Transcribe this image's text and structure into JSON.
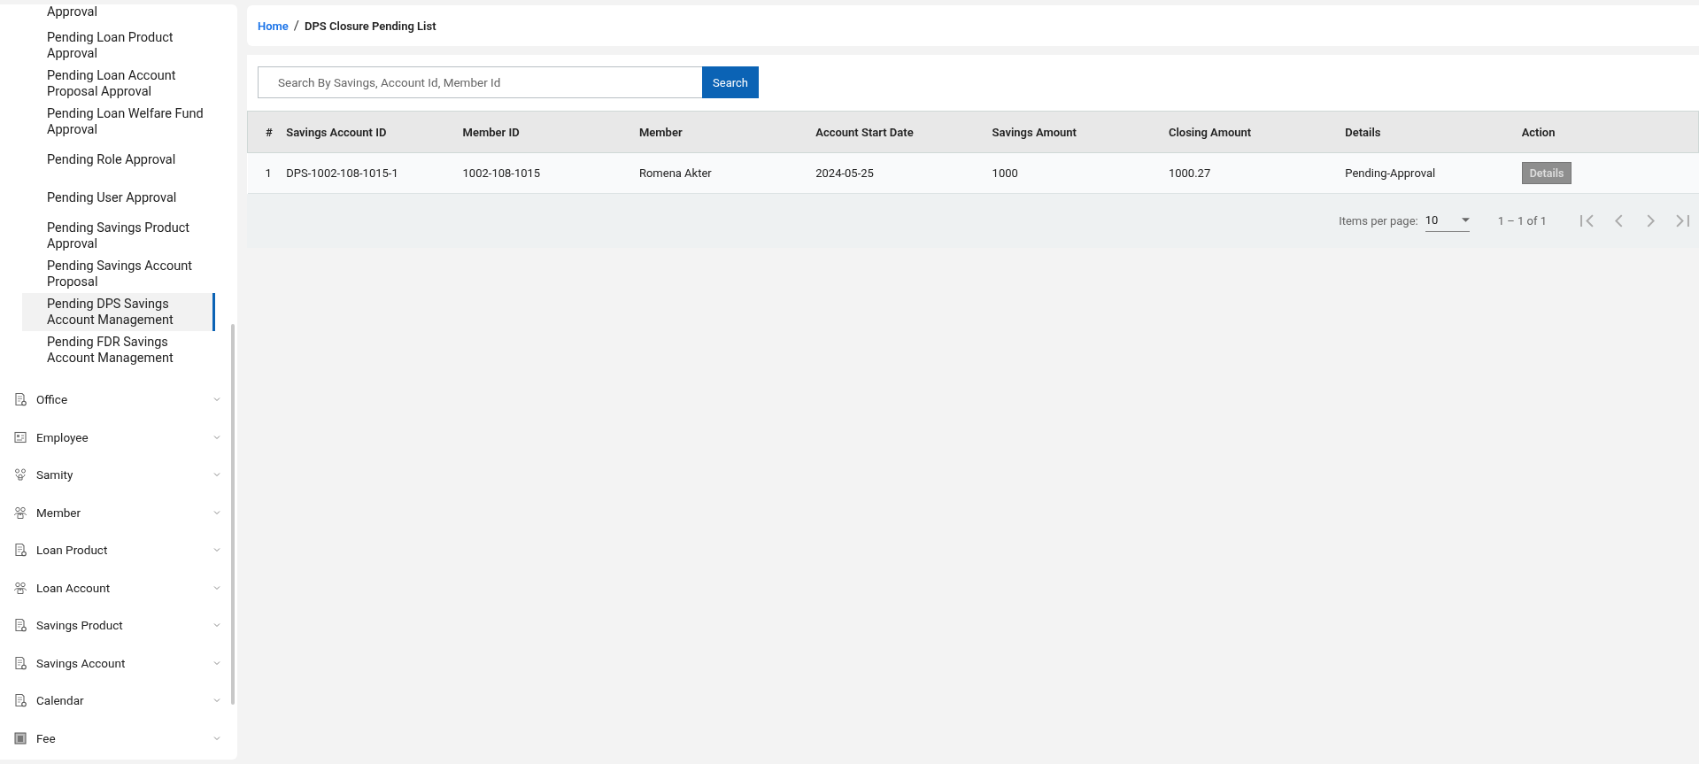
{
  "sidebar": {
    "submenu": [
      {
        "label": "Approval",
        "selected": false
      },
      {
        "label": "Pending Loan Product Approval",
        "selected": false
      },
      {
        "label": "Pending Loan Account Proposal Approval",
        "selected": false
      },
      {
        "label": "Pending Loan Welfare Fund Approval",
        "selected": false
      },
      {
        "label": "Pending Role Approval",
        "selected": false
      },
      {
        "label": "Pending User Approval",
        "selected": false
      },
      {
        "label": "Pending Savings Product Approval",
        "selected": false
      },
      {
        "label": "Pending Savings Account Proposal",
        "selected": false
      },
      {
        "label": "Pending DPS Savings Account Management",
        "selected": true
      },
      {
        "label": "Pending FDR Savings Account Management",
        "selected": false
      }
    ],
    "menu": [
      {
        "label": "Office",
        "kind": "document",
        "expanded": false
      },
      {
        "label": "Employee",
        "kind": "badge",
        "expanded": false
      },
      {
        "label": "Samity",
        "kind": "samity",
        "expanded": false
      },
      {
        "label": "Member",
        "kind": "people",
        "expanded": false
      },
      {
        "label": "Loan Product",
        "kind": "document",
        "expanded": false
      },
      {
        "label": "Loan Account",
        "kind": "people",
        "expanded": false
      },
      {
        "label": "Savings Product",
        "kind": "document",
        "expanded": false
      },
      {
        "label": "Savings Account",
        "kind": "document",
        "expanded": false
      },
      {
        "label": "Calendar",
        "kind": "document",
        "expanded": false
      },
      {
        "label": "Fee",
        "kind": "fee",
        "expanded": false
      }
    ]
  },
  "breadcrumb": {
    "home": "Home",
    "separator": "/",
    "current": "DPS Closure Pending List"
  },
  "search": {
    "placeholder": "Search By Savings, Account Id, Member Id",
    "button": "Search"
  },
  "table": {
    "columns": [
      "#",
      "Savings Account ID",
      "Member ID",
      "Member",
      "Account Start Date",
      "Savings Amount",
      "Closing Amount",
      "Details",
      "Action"
    ],
    "rows": [
      {
        "cells": [
          "1",
          "DPS-1002-108-1015-1",
          "1002-108-1015",
          "Romena Akter",
          "2024-05-25",
          "1000",
          "1000.27",
          "Pending-Approval"
        ],
        "action": "Details",
        "action_disabled": true
      }
    ]
  },
  "paginator": {
    "label": "Items per page:",
    "page_size": "10",
    "range": "1 – 1 of 1",
    "buttons": [
      {
        "kind": "first",
        "disabled": true
      },
      {
        "kind": "prev",
        "disabled": true
      },
      {
        "kind": "next",
        "disabled": true
      },
      {
        "kind": "last",
        "disabled": true
      }
    ]
  }
}
